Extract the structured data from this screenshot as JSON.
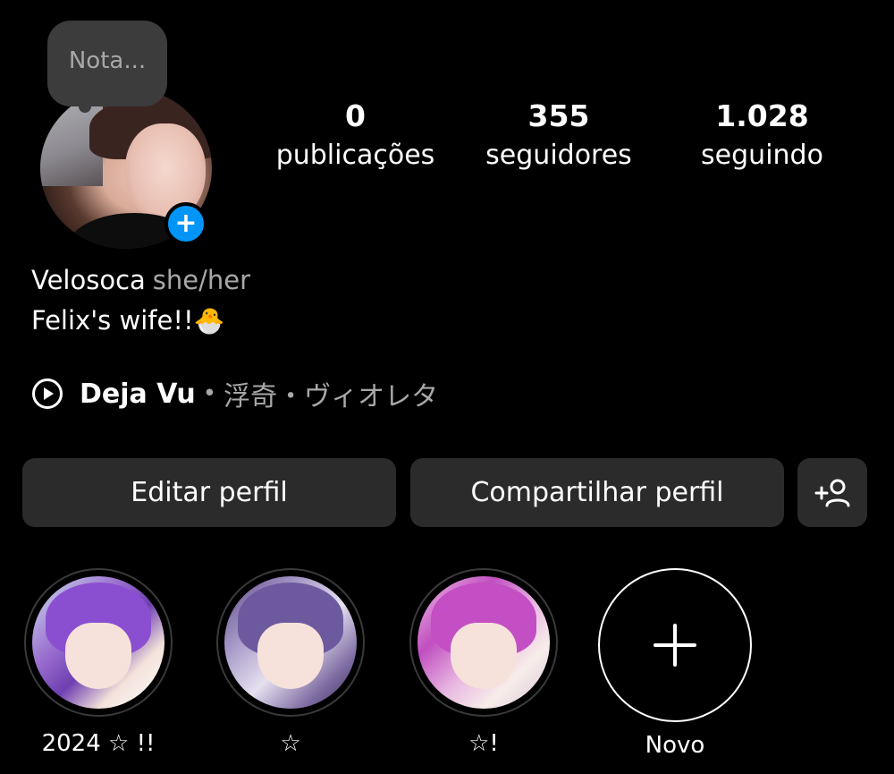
{
  "note": {
    "placeholder": "Nota..."
  },
  "stats": {
    "posts": {
      "count": "0",
      "label": "publicações"
    },
    "followers": {
      "count": "355",
      "label": "seguidores"
    },
    "following": {
      "count": "1.028",
      "label": "seguindo"
    }
  },
  "bio": {
    "name": "Velosoca",
    "pronouns": "she/her",
    "line": "Felix's wife!!",
    "emoji": "🐣"
  },
  "music": {
    "song": "Deja Vu",
    "separator": "•",
    "artist": "浮奇・ヴィオレタ",
    "icon": "play-circle-icon"
  },
  "buttons": {
    "edit": "Editar perfil",
    "share": "Compartilhar perfil",
    "add_person_icon": "add-person-icon"
  },
  "highlights": [
    {
      "label": "2024 ☆ !!"
    },
    {
      "label": "☆"
    },
    {
      "label": "☆!"
    },
    {
      "label": "Novo"
    }
  ],
  "colors": {
    "background": "#000000",
    "accent_blue": "#0095f6",
    "button_bg": "#2b2b2b",
    "muted_text": "#a8a8a8"
  }
}
